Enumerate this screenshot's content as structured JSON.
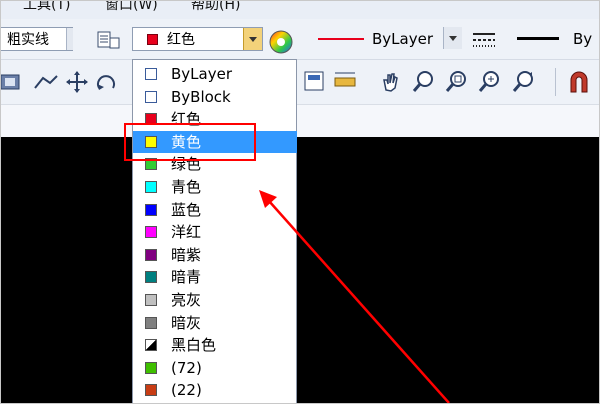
{
  "menu": {
    "tools": "工具(T)",
    "window": "窗口(W)",
    "help": "帮助(H)"
  },
  "toolbar": {
    "linetype_combo": "粗实线",
    "color_combo": {
      "value": "红色",
      "swatch_color": "#e8001c"
    },
    "linetype_line": "ByLayer",
    "lineweight_partial": "By"
  },
  "color_list": [
    {
      "label": "ByLayer",
      "color": "#ffffff"
    },
    {
      "label": "ByBlock",
      "color": "#ffffff"
    },
    {
      "label": "红色",
      "color": "#e8001c"
    },
    {
      "label": "黄色",
      "color": "#ffff00"
    },
    {
      "label": "绿色",
      "color": "#33cc33"
    },
    {
      "label": "青色",
      "color": "#00ffff"
    },
    {
      "label": "蓝色",
      "color": "#0000ff"
    },
    {
      "label": "洋红",
      "color": "#ff00ff"
    },
    {
      "label": "暗紫",
      "color": "#800080"
    },
    {
      "label": "暗青",
      "color": "#008080"
    },
    {
      "label": "亮灰",
      "color": "#c0c0c0"
    },
    {
      "label": "暗灰",
      "color": "#808080"
    },
    {
      "label": "黑白色",
      "color": "#000000"
    },
    {
      "label": "(72)",
      "color": "#3fbf00"
    },
    {
      "label": "(22)",
      "color": "#c83c14"
    }
  ],
  "selected_index": 3,
  "annotation": {
    "highlight_color": "#ff0000"
  }
}
